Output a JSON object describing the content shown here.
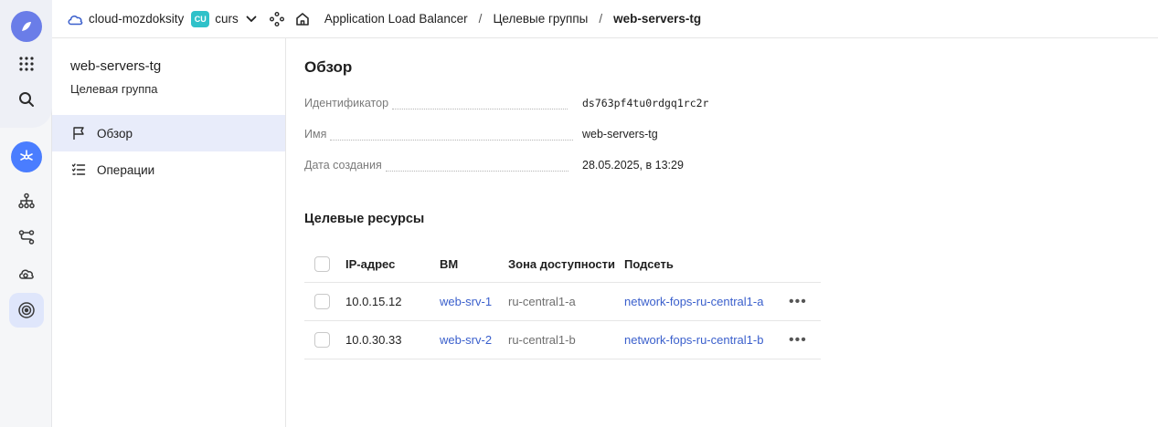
{
  "header": {
    "cloud_name": "cloud-mozdoksity",
    "folder_badge": "CU",
    "folder_name": "curs",
    "breadcrumbs": [
      "Application Load Balancer",
      "Целевые группы",
      "web-servers-tg"
    ],
    "separator": "/"
  },
  "rail": {
    "icons": [
      "logo-icon",
      "services-grid-icon",
      "search-icon",
      "load-balancer-icon",
      "topology-icon",
      "routes-icon",
      "cloud-icon",
      "target-icon"
    ]
  },
  "subnav": {
    "title": "web-servers-tg",
    "subtitle": "Целевая группа",
    "items": [
      {
        "label": "Обзор",
        "icon": "flag-icon",
        "active": true
      },
      {
        "label": "Операции",
        "icon": "list-icon",
        "active": false
      }
    ]
  },
  "overview": {
    "title": "Обзор",
    "fields": [
      {
        "key": "Идентификатор",
        "value": "ds763pf4tu0rdgq1rc2r"
      },
      {
        "key": "Имя",
        "value": "web-servers-tg"
      },
      {
        "key": "Дата создания",
        "value": "28.05.2025, в 13:29"
      }
    ]
  },
  "targets": {
    "title": "Целевые ресурсы",
    "columns": [
      "IP-адрес",
      "ВМ",
      "Зона доступности",
      "Подсеть"
    ],
    "rows": [
      {
        "ip": "10.0.15.12",
        "vm": "web-srv-1",
        "zone": "ru-central1-a",
        "subnet": "network-fops-ru-central1-a",
        "more": "•••"
      },
      {
        "ip": "10.0.30.33",
        "vm": "web-srv-2",
        "zone": "ru-central1-b",
        "subnet": "network-fops-ru-central1-b",
        "more": "•••"
      }
    ]
  },
  "colors": {
    "accent": "#4a7dff",
    "link": "#3a5fcc",
    "active_nav_bg": "#e8ecfa",
    "folder_badge": "#2fc1c9"
  }
}
